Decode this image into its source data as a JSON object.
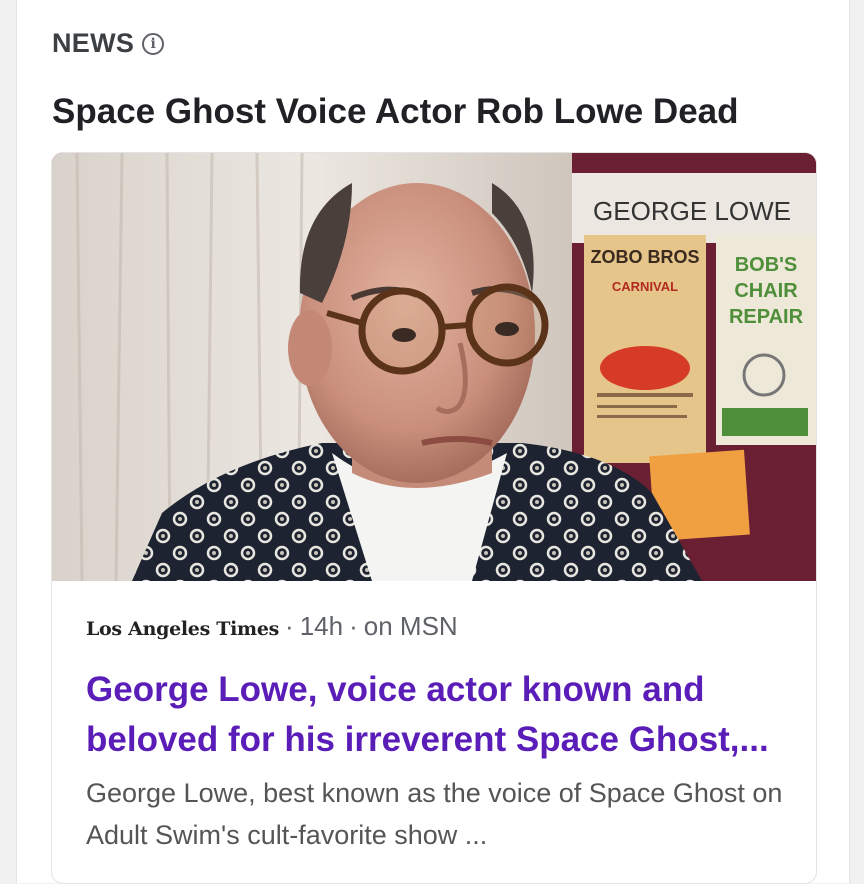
{
  "section": {
    "label": "NEWS",
    "info_icon": "info-icon"
  },
  "headline": "Space Ghost Voice Actor Rob Lowe Dead",
  "story": {
    "source": "Los Angeles Times",
    "age": "14h",
    "via": "on MSN",
    "title": "George Lowe, voice actor known and beloved for his irreverent Space Ghost,...",
    "snippet": "George Lowe, best known as the voice of Space Ghost on Adult Swim's cult-favorite show ...",
    "image": {
      "sign_name": "GEORGE LOWE",
      "poster_1_line1": "ZOBO BROS",
      "poster_1_line2": "CARNIVAL",
      "poster_2_line1": "BOB'S",
      "poster_2_line2": "CHAIR",
      "poster_2_line3": "REPAIR"
    }
  },
  "colors": {
    "title_link": "#5b1db8",
    "headline": "#202124",
    "muted": "#5f6368"
  }
}
